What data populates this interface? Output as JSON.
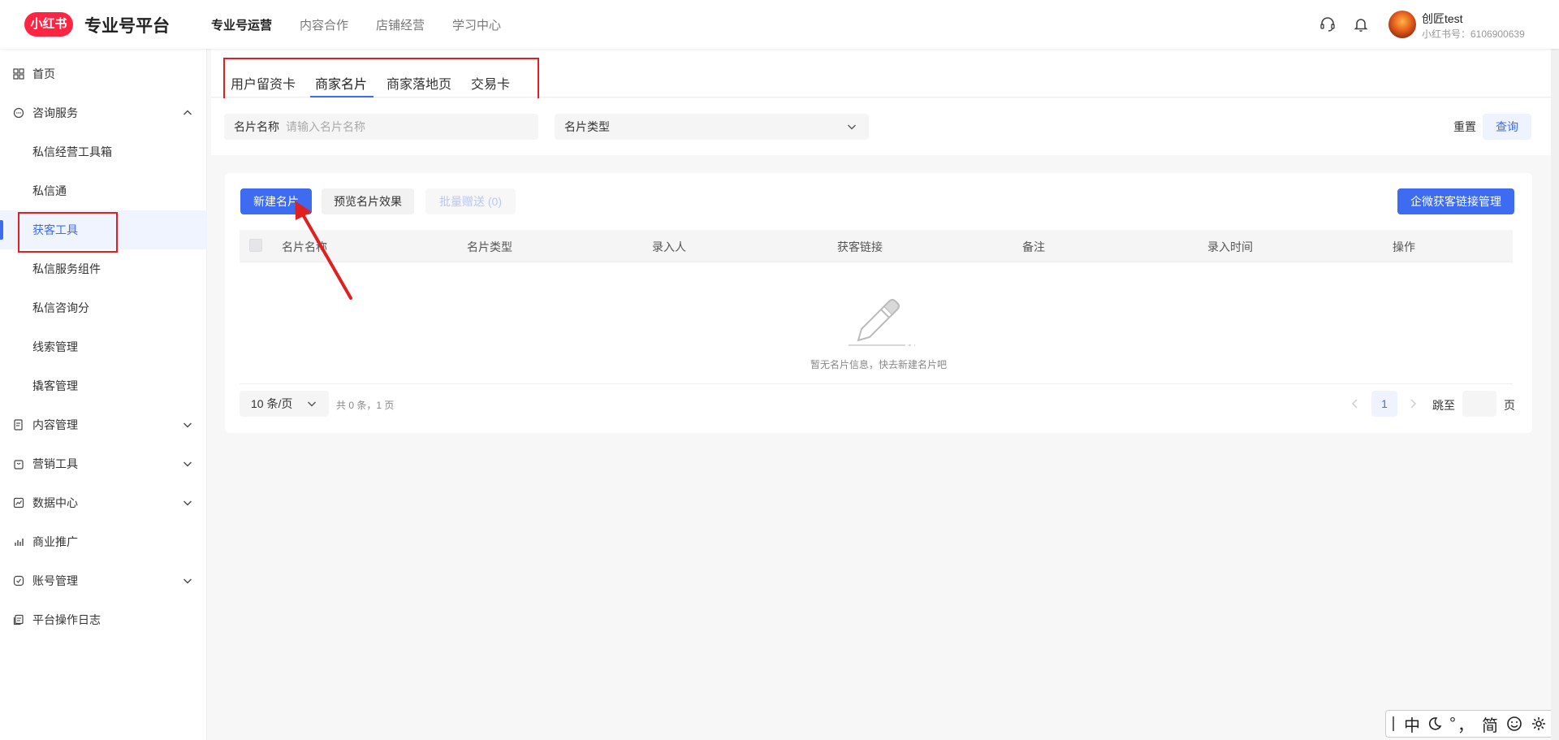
{
  "header": {
    "logo_badge": "小红书",
    "logo_title": "专业号平台",
    "nav": [
      "专业号运营",
      "内容合作",
      "店铺经营",
      "学习中心"
    ],
    "active_nav": "专业号运营",
    "user_name": "创匠test",
    "user_id": "小红书号：6106900639"
  },
  "sidebar": {
    "items": [
      {
        "label": "首页",
        "icon": "grid-icon"
      },
      {
        "label": "咨询服务",
        "icon": "chat-bubble-icon",
        "expanded": true
      },
      {
        "label": "私信经营工具箱",
        "sub": true
      },
      {
        "label": "私信通",
        "sub": true
      },
      {
        "label": "获客工具",
        "sub": true,
        "active": true
      },
      {
        "label": "私信服务组件",
        "sub": true
      },
      {
        "label": "私信咨询分",
        "sub": true
      },
      {
        "label": "线索管理",
        "sub": true
      },
      {
        "label": "撬客管理",
        "sub": true
      },
      {
        "label": "内容管理",
        "icon": "document-icon"
      },
      {
        "label": "营销工具",
        "icon": "bag-icon"
      },
      {
        "label": "数据中心",
        "icon": "chart-icon"
      },
      {
        "label": "商业推广",
        "icon": "bar-chart-icon"
      },
      {
        "label": "账号管理",
        "icon": "shield-icon"
      },
      {
        "label": "平台操作日志",
        "icon": "log-icon"
      }
    ]
  },
  "tabs": [
    "用户留资卡",
    "商家名片",
    "商家落地页",
    "交易卡"
  ],
  "active_tab": "商家名片",
  "filters": {
    "name_label": "名片名称",
    "name_placeholder": "请输入名片名称",
    "type_label": "名片类型",
    "reset_label": "重置",
    "query_label": "查询"
  },
  "toolbar": {
    "new_card": "新建名片",
    "preview": "预览名片效果",
    "batch_send": "批量赠送 (0)",
    "wecom_link": "企微获客链接管理"
  },
  "table": {
    "columns": [
      "名片名称",
      "名片类型",
      "录入人",
      "获客链接",
      "备注",
      "录入时间",
      "操作"
    ],
    "rows": [],
    "empty_text": "暂无名片信息，快去新建名片吧"
  },
  "pagination": {
    "page_size": "10 条/页",
    "total": "共 0 条，1 页",
    "current_page": "1",
    "jump_label": "跳至",
    "page_label": "页"
  },
  "ime": {
    "mode": "中",
    "width": "°",
    "punct": "，",
    "script": "简"
  },
  "colors": {
    "brand": "#ff2442",
    "accent": "#3d6cf0",
    "annotation": "#e02020"
  }
}
